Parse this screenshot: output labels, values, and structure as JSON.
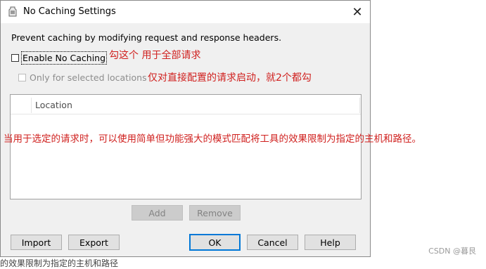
{
  "window": {
    "title": "No Caching Settings",
    "close_glyph": "✕"
  },
  "description": "Prevent caching by modifying request and response headers.",
  "enable_checkbox": {
    "label": "Enable No Caching",
    "checked": false
  },
  "selected_checkbox": {
    "label": "Only for selected locations",
    "checked": false,
    "enabled": false
  },
  "list": {
    "column_header": "Location",
    "rows": []
  },
  "list_buttons": {
    "add": "Add",
    "remove": "Remove"
  },
  "footer_buttons": {
    "import": "Import",
    "export": "Export",
    "ok": "OK",
    "cancel": "Cancel",
    "help": "Help"
  },
  "annotations": {
    "a1": "勾这个  用于全部请求",
    "a2": "仅对直接配置的请求启动，就2个都勾",
    "a3": "当用于选定的请求时，可以使用简单但功能强大的模式匹配将工具的效果限制为指定的主机和路径。"
  },
  "watermark": "CSDN @暮艮",
  "bottom_text": "的效果限制为指定的主机和路径",
  "colors": {
    "annotation": "#d0211f",
    "focus_border": "#0078d7",
    "dialog_bg": "#f0f0f0"
  }
}
